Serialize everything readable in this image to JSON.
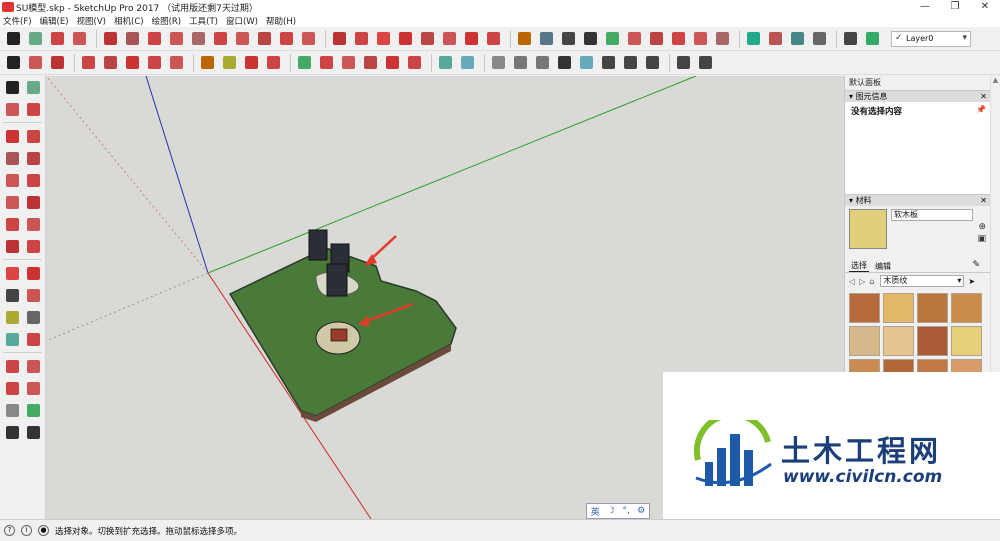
{
  "window": {
    "title": "SU模型.skp - SketchUp Pro 2017 （试用版还剩7天过期）",
    "controls": [
      "—",
      "❐",
      "✕"
    ]
  },
  "menu": [
    "文件(F)",
    "编辑(E)",
    "视图(V)",
    "相机(C)",
    "绘图(R)",
    "工具(T)",
    "窗口(W)",
    "帮助(H)"
  ],
  "toolbar": {
    "layer_value": "Layer0",
    "row1_colors": [
      "#222",
      "#6a8",
      "#c44",
      "#c55",
      "#b33",
      "#a55",
      "#c44",
      "#c55",
      "#a66",
      "#c44",
      "#c55",
      "#b44",
      "#c44",
      "#c55",
      "#b33",
      "#c44",
      "#d44",
      "#c33",
      "#b44",
      "#c55",
      "#c33",
      "#c44",
      "#b60",
      "#578",
      "#444",
      "#333",
      "#4a6",
      "#c55",
      "#b44",
      "#c44",
      "#c55",
      "#a66",
      "#2a8",
      "#b55",
      "#488",
      "#666",
      "#444",
      "#3a6"
    ],
    "row2_colors": [
      "#222",
      "#c55",
      "#b33",
      "#c44",
      "#b44",
      "#c33",
      "#c44",
      "#c55",
      "#b60",
      "#aa3",
      "#c33",
      "#c44",
      "#4a6",
      "#c44",
      "#c55",
      "#b44",
      "#c33",
      "#c44",
      "#5a9",
      "#6ab",
      "#888",
      "#777",
      "#777",
      "#333",
      "#6ab",
      "#444",
      "#444",
      "#444",
      "#444",
      "#444"
    ]
  },
  "palette": {
    "colors": [
      "#222",
      "#6a8",
      "#c55",
      "#c44",
      "#c33",
      "#c44",
      "#a55",
      "#b44",
      "#c55",
      "#c44",
      "#c55",
      "#b33",
      "#c44",
      "#c55",
      "#b33",
      "#c44",
      "#d44",
      "#c33",
      "#444",
      "#c55",
      "#aa3",
      "#666",
      "#5a9",
      "#c44",
      "#c44",
      "#c55",
      "#c44",
      "#c55",
      "#888",
      "#4a6",
      "#333",
      "#333"
    ]
  },
  "viewport": {
    "ime": [
      "英",
      "☽",
      "°,",
      "⚙"
    ]
  },
  "tray": {
    "title": "默认面板",
    "entity_info": {
      "header": "图元信息",
      "content": "没有选择内容"
    },
    "materials": {
      "header": "材料",
      "material_name": "软木板",
      "swatch_color": "#e2cf7c",
      "tab_select": "选择",
      "tab_edit": "编辑",
      "library": "木质纹",
      "swatches": [
        "#b86a3a",
        "#e2b866",
        "#b9773d",
        "#c98c4a",
        "#d6b98a",
        "#e7c590",
        "#a85b35",
        "#e8d07a",
        "#c98b52",
        "#b0673a",
        "#c17845",
        "#d89c6a"
      ]
    }
  },
  "status": {
    "text": "选择对象。切换到扩充选择。拖动鼠标选择多项。"
  },
  "watermark": {
    "cn": "土木工程网",
    "url": "www.civilcn.com"
  }
}
